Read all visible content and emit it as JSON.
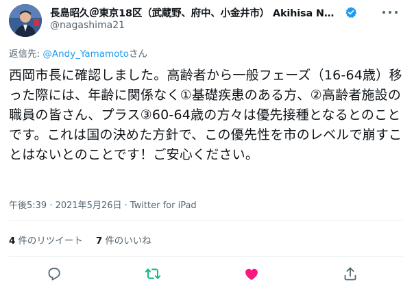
{
  "author": {
    "display_name": "長島昭久＠東京18区（武蔵野、府中、小金井市） Akihisa NAG...",
    "handle": "@nagashima21"
  },
  "reply_to": {
    "prefix": "返信先: ",
    "mention": "@Andy_Yamamoto",
    "suffix": "さん"
  },
  "tweet": {
    "text": "西岡市長に確認しました。高齢者から一般フェーズ（16-64歳）移った際には、年齢に関係なく①基礎疾患のある方、②高齢者施設の職員の皆さん、プラス③60-64歳の方々は優先接種となるとのことです。これは国の決めた方針で、この優先性を市のレベルで崩すことはないとのことです！ご安心ください。",
    "timestamp": "午後5:39 · 2021年5月26日 · Twitter for iPad"
  },
  "stats": {
    "retweets_count": "4",
    "retweets_label": "件のリツイート",
    "likes_count": "7",
    "likes_label": "件のいいね"
  },
  "icons": {
    "verified": "verified-badge-icon",
    "more": "more-icon",
    "reply": "reply-icon",
    "retweet": "retweet-icon",
    "like": "like-icon",
    "share": "share-icon"
  },
  "colors": {
    "link": "#1d9bf0",
    "retweet": "#00ba7c",
    "like": "#f91880",
    "secondary_text": "#536471"
  }
}
